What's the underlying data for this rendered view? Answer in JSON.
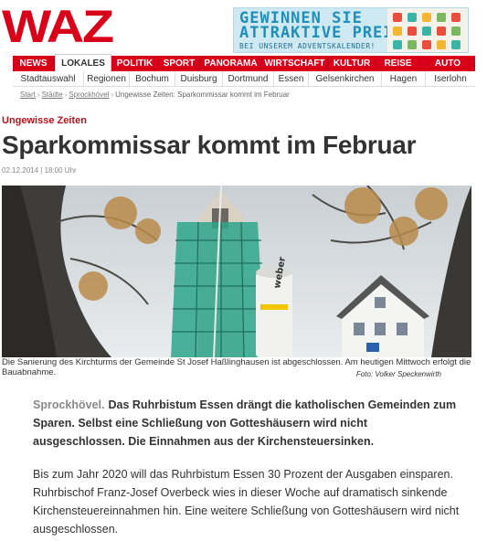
{
  "logo": "WAZ",
  "ad": {
    "line1": "GEWINNEN SIE",
    "line2": "ATTRAKTIVE PREISE",
    "line3": "BEI UNSEREM ADVENTSKALENDER!"
  },
  "main_nav": [
    {
      "label": "NEWS",
      "active": false
    },
    {
      "label": "LOKALES",
      "active": true
    },
    {
      "label": "POLITIK",
      "active": false
    },
    {
      "label": "SPORT",
      "active": false
    },
    {
      "label": "PANORAMA",
      "active": false
    },
    {
      "label": "WIRTSCHAFT",
      "active": false
    },
    {
      "label": "KULTUR",
      "active": false
    },
    {
      "label": "REISE",
      "active": false
    },
    {
      "label": "AUTO",
      "active": false
    }
  ],
  "sub_nav": [
    "Stadtauswahl",
    "Regionen",
    "Bochum",
    "Duisburg",
    "Dortmund",
    "Essen",
    "Gelsenkirchen",
    "Hagen",
    "Iserlohn"
  ],
  "breadcrumb": {
    "items": [
      "Start",
      "Städte",
      "Sprockhövel"
    ],
    "current": "Ungewisse Zeiten: Sparkommissar kommt im Februar"
  },
  "article": {
    "kicker": "Ungewisse Zeiten",
    "headline": "Sparkommissar kommt im Februar",
    "dateline": "02.12.2014 | 18:00 Uhr",
    "caption": "Die Sanierung des Kirchturms der Gemeinde St Josef Haßlinghausen ist abgeschlossen. Am heutigen Mittwoch erfolgt die Bauabnahme.",
    "credit": "Foto: Volker Speckenwirth",
    "lead_place": "Sprockhövel.",
    "lead_text": "Das Ruhrbistum Essen drängt die katholischen Gemeinden zum Sparen. Selbst eine Schließung von Gotteshäusern wird nicht ausgeschlossen. Die Einnahmen aus der Kirchensteuersinken.",
    "body": "Bis zum Jahr 2020 will das Ruhrbistum Essen 30 Prozent der Ausgaben einsparen. Ruhrbischof Franz-Josef Overbeck wies in dieser Woche auf dramatisch sinkende Kirchensteuereinnahmen hin. Eine weitere Schließung von Gotteshäusern wird nicht ausgeschlossen.",
    "silo_text": "weber"
  },
  "colors": {
    "brand": "#d90019",
    "kicker": "#b3141d"
  }
}
